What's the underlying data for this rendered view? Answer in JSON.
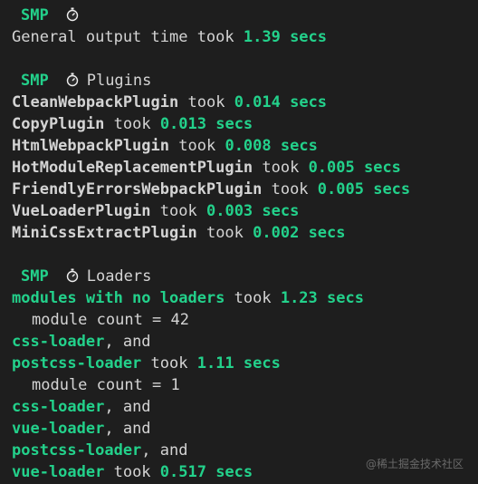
{
  "smp_tag": "SMP",
  "general": {
    "label": "General output time took",
    "time": "1.39 secs"
  },
  "plugins": {
    "title": "Plugins",
    "items": [
      {
        "name": "CleanWebpackPlugin",
        "took": "took",
        "time": "0.014 secs"
      },
      {
        "name": "CopyPlugin",
        "took": "took",
        "time": "0.013 secs"
      },
      {
        "name": "HtmlWebpackPlugin",
        "took": "took",
        "time": "0.008 secs"
      },
      {
        "name": "HotModuleReplacementPlugin",
        "took": "took",
        "time": "0.005 secs"
      },
      {
        "name": "FriendlyErrorsWebpackPlugin",
        "took": "took",
        "time": "0.005 secs"
      },
      {
        "name": "VueLoaderPlugin",
        "took": "took",
        "time": "0.003 secs"
      },
      {
        "name": "MiniCssExtractPlugin",
        "took": "took",
        "time": "0.002 secs"
      }
    ]
  },
  "loaders": {
    "title": "Loaders",
    "lines": [
      {
        "loader": "modules with no loaders",
        "suffix": " took ",
        "time": "1.23 secs"
      },
      {
        "text": "module count = 42"
      },
      {
        "loader": "css-loader",
        "suffix": ", and"
      },
      {
        "loader": "postcss-loader",
        "suffix": " took ",
        "time": "1.11 secs"
      },
      {
        "text": "module count = 1"
      },
      {
        "loader": "css-loader",
        "suffix": ", and"
      },
      {
        "loader": "vue-loader",
        "suffix": ", and"
      },
      {
        "loader": "postcss-loader",
        "suffix": ", and"
      },
      {
        "loader": "vue-loader",
        "suffix": " took ",
        "time": "0.517 secs"
      }
    ]
  },
  "watermark": "@稀土掘金技术社区",
  "icons": {
    "stopwatch": "stopwatch-icon"
  },
  "colors": {
    "background": "#1e1e1e",
    "text": "#d4d4d4",
    "accent_green": "#23d18b"
  }
}
